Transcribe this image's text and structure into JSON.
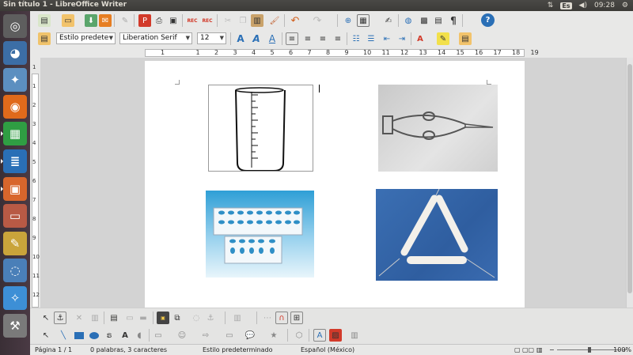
{
  "window": {
    "title": "Sin título 1 - LibreOffice Writer"
  },
  "tray": {
    "net_icon": "transfer-arrows-icon",
    "keyboard_layout": "Es",
    "volume_icon": "speaker-icon",
    "time": "09:28",
    "gear_icon": "gear-icon"
  },
  "launcher": {
    "items": [
      {
        "name": "ubuntu-dash",
        "glyph": "◎",
        "color": "#5e5e5e"
      },
      {
        "name": "gimp",
        "glyph": "◕",
        "color": "#3c6ea6"
      },
      {
        "name": "compass",
        "glyph": "✦",
        "color": "#5c8fc0"
      },
      {
        "name": "firefox",
        "glyph": "◉",
        "color": "#e06a1b"
      },
      {
        "name": "libreoffice-calc",
        "glyph": "▦",
        "color": "#2f9e43"
      },
      {
        "name": "libreoffice-writer",
        "glyph": "≣",
        "color": "#2a6fb6"
      },
      {
        "name": "libreoffice-impress",
        "glyph": "▣",
        "color": "#d8662c"
      },
      {
        "name": "archive-manager",
        "glyph": "▭",
        "color": "#b85a45"
      },
      {
        "name": "pencil-app",
        "glyph": "✎",
        "color": "#c9a43b"
      },
      {
        "name": "network-app",
        "glyph": "◌",
        "color": "#4a7fb8"
      },
      {
        "name": "inkscape",
        "glyph": "✧",
        "color": "#3d8fd6"
      },
      {
        "name": "tools-app",
        "glyph": "⚒",
        "color": "#7a7a7a"
      }
    ]
  },
  "formatting": {
    "paragraph_style": "Estilo predete",
    "font_name": "Liberation Serif",
    "font_size": "12"
  },
  "ruler": {
    "h_labels": [
      "1",
      "1",
      "2",
      "3",
      "4",
      "5",
      "6",
      "7",
      "8",
      "9",
      "10",
      "11",
      "12",
      "13",
      "14",
      "15",
      "16",
      "17",
      "18",
      "19"
    ],
    "v_labels": [
      "1",
      "1",
      "2",
      "3",
      "4",
      "5",
      "6",
      "7",
      "8",
      "9",
      "10",
      "11",
      "12"
    ]
  },
  "document": {
    "images": [
      {
        "name": "beaker-image",
        "description_icon": "beaker-icon"
      },
      {
        "name": "crucible-tongs-image",
        "description_icon": "tongs-icon"
      },
      {
        "name": "test-tube-rack-image",
        "description_icon": "rack-icon"
      },
      {
        "name": "clay-triangle-image",
        "description_icon": "triangle-icon"
      }
    ]
  },
  "status": {
    "page": "Página 1 / 1",
    "words": "0 palabras, 3 caracteres",
    "style": "Estilo predeterminado",
    "language": "Español (México)",
    "zoom": "100%"
  },
  "colors": {
    "accent_red": "#d23a2a",
    "accent_blue": "#2a6fb6",
    "page_bg": "#ffffff"
  }
}
